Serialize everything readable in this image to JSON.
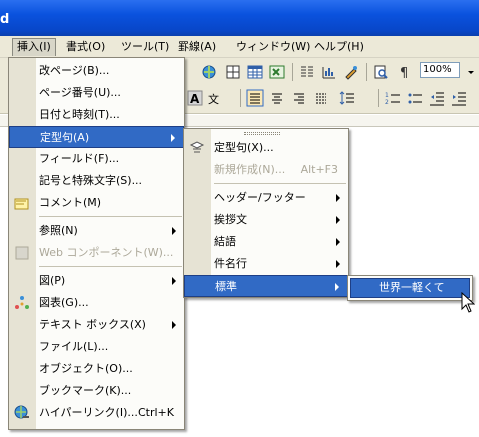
{
  "titlebar": {
    "title_char": "d"
  },
  "menubar": {
    "items": [
      {
        "label": "挿入(I)"
      },
      {
        "label": "書式(O)"
      },
      {
        "label": "ツール(T)"
      },
      {
        "label": "罫線(A)"
      },
      {
        "label": "ウィンドウ(W)"
      },
      {
        "label": "ヘルプ(H)"
      }
    ]
  },
  "toolbar": {
    "zoom": "100%"
  },
  "insert_menu": {
    "items": [
      {
        "label": "改ページ(B)..."
      },
      {
        "label": "ページ番号(U)..."
      },
      {
        "label": "日付と時刻(T)..."
      },
      {
        "label": "定型句(A)"
      },
      {
        "label": "フィールド(F)..."
      },
      {
        "label": "記号と特殊文字(S)..."
      },
      {
        "label": "コメント(M)"
      },
      {
        "label": "参照(N)"
      },
      {
        "label": "Web コンポーネント(W)..."
      },
      {
        "label": "図(P)"
      },
      {
        "label": "図表(G)..."
      },
      {
        "label": "テキスト ボックス(X)"
      },
      {
        "label": "ファイル(L)..."
      },
      {
        "label": "オブジェクト(O)..."
      },
      {
        "label": "ブックマーク(K)..."
      },
      {
        "label": "ハイパーリンク(I)...",
        "shortcut": "Ctrl+K"
      }
    ]
  },
  "autotext_menu": {
    "items": [
      {
        "label": "定型句(X)..."
      },
      {
        "label": "新規作成(N)...",
        "shortcut": "Alt+F3"
      },
      {
        "label": "ヘッダー/フッター"
      },
      {
        "label": "挨拶文"
      },
      {
        "label": "結語"
      },
      {
        "label": "件名行"
      },
      {
        "label": "標準"
      }
    ]
  },
  "standard_menu": {
    "items": [
      {
        "label": "世界一軽くて"
      }
    ]
  }
}
